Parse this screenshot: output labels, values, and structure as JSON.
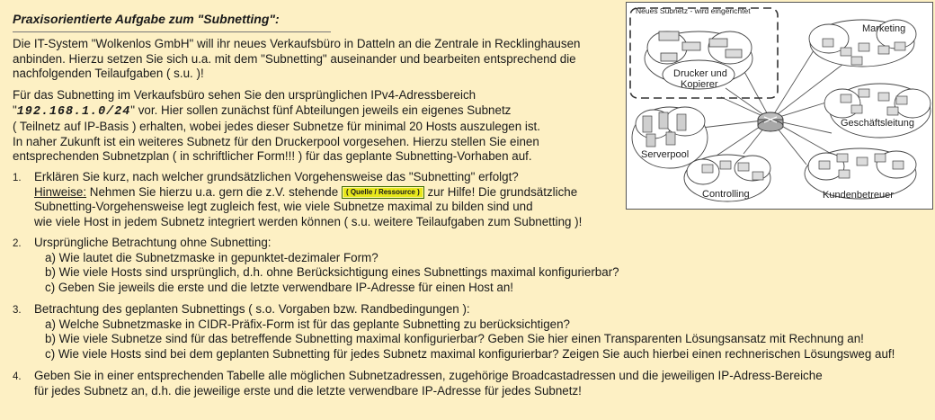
{
  "title": "Praxisorientierte Aufgabe zum \"Subnetting\":",
  "intro": [
    "Die IT-System \"Wolkenlos GmbH\" will ihr neues Verkaufsbüro in Datteln an die Zentrale in Recklinghausen",
    "anbinden. Hierzu setzen Sie sich u.a. mit dem \"Subnetting\" auseinander und bearbeiten entsprechend die",
    "nachfolgenden Teilaufgaben ( s.u. )!"
  ],
  "para2": {
    "line1": "Für das Subnetting im Verkaufsbüro sehen Sie den ursprünglichen IPv4-Adressbereich",
    "ip_prefix": "\"",
    "ip": "192.168.1.0/24",
    "ip_suffix": "\" vor. Hier sollen zunächst fünf Abteilungen jeweils ein eigenes Subnetz",
    "line3": "( Teilnetz auf IP-Basis ) erhalten, wobei jedes dieser Subnetze für minimal 20 Hosts auszulegen ist.",
    "line4": "In naher Zukunft ist ein weiteres Subnetz für den Druckerpool vorgesehen. Hierzu stellen Sie einen",
    "line5": "entsprechenden Subnetzplan ( in schriftlicher Form!!! ) für das geplante Subnetting-Vorhaben auf."
  },
  "tasks": [
    {
      "num": "1.",
      "line1": "Erklären Sie kurz, nach welcher grundsätzlichen Vorgehensweise das \"Subnetting\" erfolgt?",
      "hint_label": "Hinweise:",
      "hint_a": " Nehmen Sie hierzu u.a. gern die z.V. stehende ",
      "button": "( Quelle /  Ressource )",
      "hint_b": " zur Hilfe! Die grundsätzliche",
      "line3": "Subnetting-Vorgehensweise legt zugleich fest, wie viele Subnetze maximal zu bilden sind und",
      "line4": "wie viele Host in jedem Subnetz integriert werden können ( s.u. weitere Teilaufgaben zum Subnetting )!"
    },
    {
      "num": "2.",
      "line1": "Ursprüngliche Betrachtung ohne Subnetting:",
      "a": "a) Wie lautet die Subnetzmaske in gepunktet-dezimaler Form?",
      "b": "b) Wie viele Hosts sind ursprünglich, d.h. ohne Berücksichtigung eines Subnettings maximal konfigurierbar?",
      "c": "c) Geben Sie jeweils die erste und die letzte verwendbare IP-Adresse für einen Host an!"
    },
    {
      "num": "3.",
      "line1": "Betrachtung des geplanten Subnettings ( s.o. Vorgaben bzw. Randbedingungen ):",
      "a": "a) Welche Subnetzmaske in CIDR-Präfix-Form ist für das geplante Subnetting zu berücksichtigen?",
      "b": "b) Wie viele Subnetze sind für das betreffende Subnetting maximal konfigurierbar? Geben Sie hier einen Transparenten Lösungsansatz mit Rechnung an!",
      "c": "c) Wie viele Hosts sind bei dem geplanten Subnetting für jedes Subnetz maximal konfigurierbar? Zeigen Sie auch hierbei einen rechnerischen Lösungsweg auf!"
    },
    {
      "num": "4.",
      "line1": "Geben Sie in einer entsprechenden Tabelle alle möglichen Subnetzadressen, zugehörige Broadcastadressen und die jeweiligen IP-Adress-Bereiche",
      "line2": "für jedes Subnetz an, d.h. die jeweilige erste und die letzte verwendbare IP-Adresse für jedes Subnetz!"
    }
  ],
  "diagram": {
    "new_subnet": "Neues Subnetz - wird eingerichtet",
    "printer": [
      "Drucker und",
      "Kopierer"
    ],
    "marketing": "Marketing",
    "management": "Geschäftsleitung",
    "serverpool": "Serverpool",
    "controlling": "Controlling",
    "customer": "Kundenbetreuer"
  }
}
